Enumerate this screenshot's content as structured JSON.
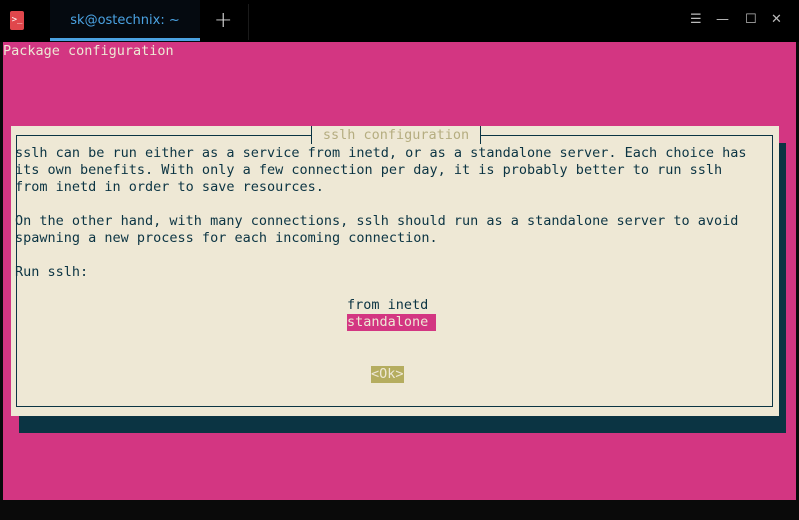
{
  "window": {
    "tab_title": "sk@ostechnix: ~",
    "new_tab_label": "+",
    "menu_icon": "☰",
    "minimize_icon": "—",
    "maximize_icon": "☐",
    "close_icon": "✕",
    "app_icon": ">_"
  },
  "terminal": {
    "header": "Package configuration",
    "dialog": {
      "title": "sslh configuration",
      "paragraph1": [
        "sslh can be run either as a service from inetd, or as a standalone server. Each choice has",
        "its own benefits. With only a few connection per day, it is probably better to run sslh",
        "from inetd in order to save resources."
      ],
      "paragraph2": [
        "On the other hand, with many connections, sslh should run as a standalone server to avoid",
        "spawning a new process for each incoming connection."
      ],
      "prompt": "Run sslh:",
      "options": [
        "from inetd",
        "standalone "
      ],
      "selected_option": "standalone",
      "ok_button": "<Ok>"
    }
  },
  "colors": {
    "background": "#d33682",
    "dialog": "#eee8d5",
    "text": "#0b3443",
    "tab_accent": "#4ba3e3"
  }
}
